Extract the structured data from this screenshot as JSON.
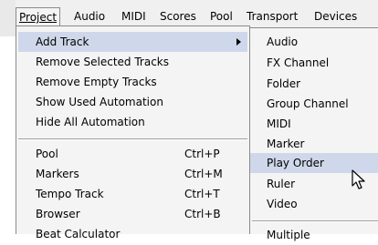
{
  "menubar": {
    "project": "Project",
    "audio": "Audio",
    "midi": "MIDI",
    "scores": "Scores",
    "pool": "Pool",
    "transport": "Transport",
    "devices": "Devices"
  },
  "project_menu": {
    "add_track": "Add Track",
    "remove_selected_tracks": "Remove Selected Tracks",
    "remove_empty_tracks": "Remove Empty Tracks",
    "show_used_automation": "Show Used Automation",
    "hide_all_automation": "Hide All Automation",
    "pool": "Pool",
    "pool_shortcut": "Ctrl+P",
    "markers": "Markers",
    "markers_shortcut": "Ctrl+M",
    "tempo_track": "Tempo Track",
    "tempo_track_shortcut": "Ctrl+T",
    "browser": "Browser",
    "browser_shortcut": "Ctrl+B",
    "beat_calculator": "Beat Calculator"
  },
  "add_track_submenu": {
    "audio": "Audio",
    "fx_channel": "FX Channel",
    "folder": "Folder",
    "group_channel": "Group Channel",
    "midi": "MIDI",
    "marker": "Marker",
    "play_order": "Play Order",
    "ruler": "Ruler",
    "video": "Video",
    "multiple": "Multiple"
  },
  "icons": {
    "submenu_arrow": "triangle-right-icon",
    "cursor": "arrow-cursor-icon"
  },
  "colors": {
    "highlight": "#cfd8ea"
  }
}
